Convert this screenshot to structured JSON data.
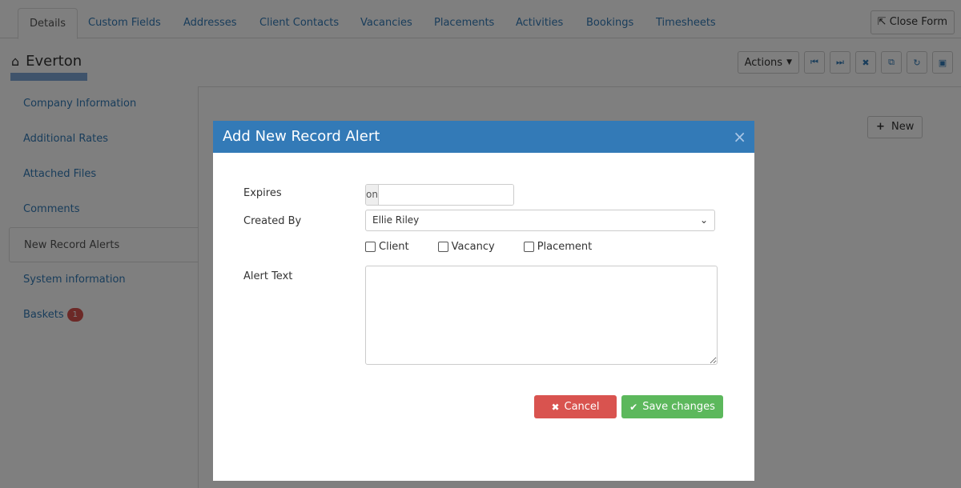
{
  "tabs": [
    {
      "label": "Details"
    },
    {
      "label": "Custom Fields"
    },
    {
      "label": "Addresses"
    },
    {
      "label": "Client Contacts"
    },
    {
      "label": "Vacancies"
    },
    {
      "label": "Placements"
    },
    {
      "label": "Activities"
    },
    {
      "label": "Bookings"
    },
    {
      "label": "Timesheets"
    }
  ],
  "close_form_label": "Close Form",
  "record": {
    "title": "Everton"
  },
  "toolbar": {
    "actions_label": "Actions"
  },
  "side_menu": [
    {
      "label": "Company Information"
    },
    {
      "label": "Additional Rates"
    },
    {
      "label": "Attached Files"
    },
    {
      "label": "Comments"
    },
    {
      "label": "New Record Alerts"
    },
    {
      "label": "System information"
    },
    {
      "label": "Baskets",
      "badge": "1"
    }
  ],
  "panel": {
    "new_label": "New"
  },
  "modal": {
    "title": "Add New Record Alert",
    "close_glyph": "×",
    "expires_label": "Expires",
    "expires_prefix": "on",
    "expires_value": "",
    "created_by_label": "Created By",
    "created_by_value": "Ellie Riley",
    "checkboxes": [
      {
        "label": "Client",
        "checked": false
      },
      {
        "label": "Vacancy",
        "checked": false
      },
      {
        "label": "Placement",
        "checked": false
      }
    ],
    "alert_text_label": "Alert Text",
    "alert_text_value": "",
    "cancel_label": "Cancel",
    "save_label": "Save changes"
  },
  "colors": {
    "primary": "#337ab7",
    "danger": "#d9534f",
    "success": "#5cb85c"
  }
}
